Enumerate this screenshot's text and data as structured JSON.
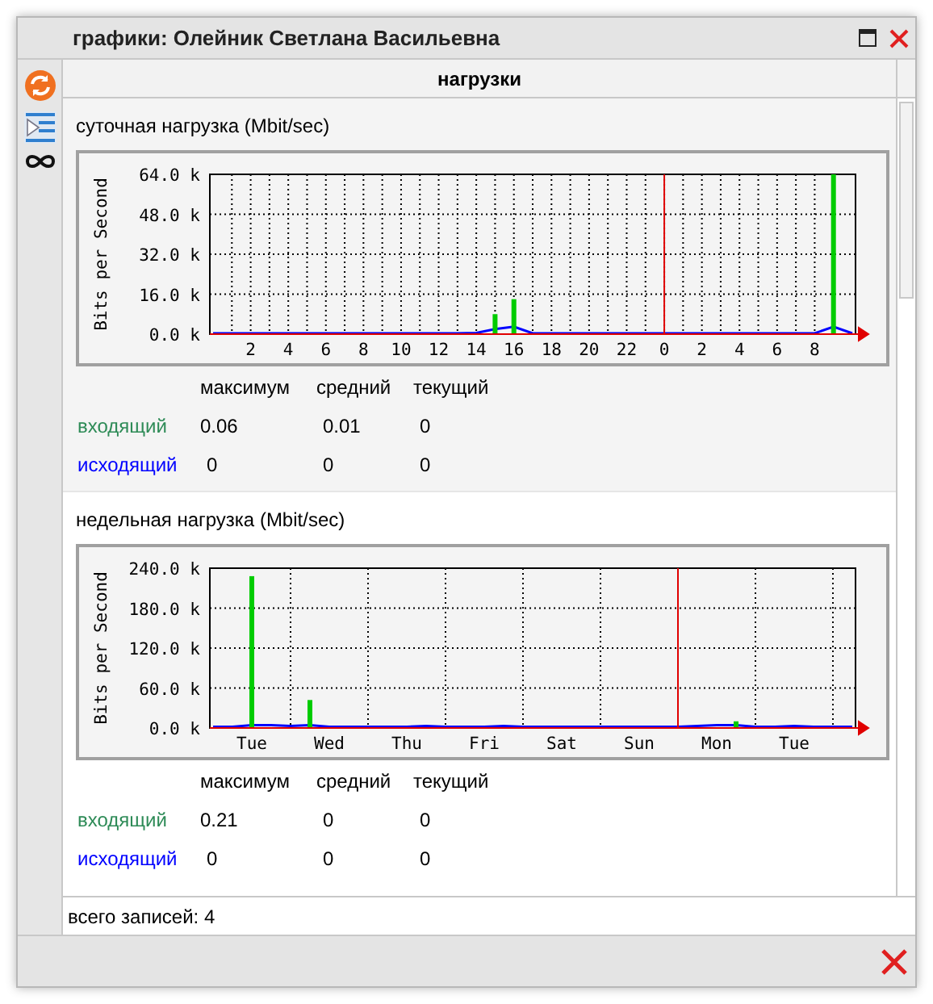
{
  "window": {
    "title": "графики: Олейник Светлана Васильевна"
  },
  "panel": {
    "title": "нагрузки"
  },
  "sections": [
    {
      "title": "суточная нагрузка (Mbit/sec)",
      "chart_data": {
        "type": "bar",
        "ylabel": "Bits per Second",
        "categories": [
          null,
          null,
          "2",
          null,
          "4",
          null,
          "6",
          null,
          "8",
          null,
          "10",
          null,
          "12",
          null,
          "14",
          null,
          "16",
          null,
          "18",
          null,
          "20",
          null,
          "22",
          null,
          "0",
          null,
          "2",
          null,
          "4",
          null,
          "6",
          null,
          "8",
          null,
          null
        ],
        "series": [
          {
            "name": "входящий",
            "color": "#00cc00",
            "values": [
              0,
              0,
              0,
              0,
              0,
              0,
              0,
              0,
              0,
              0,
              0,
              0,
              0,
              0,
              0,
              8,
              14,
              0,
              0,
              0,
              0,
              0,
              0,
              0,
              0,
              0,
              0,
              0,
              0,
              0,
              0,
              0,
              0,
              64,
              0
            ]
          },
          {
            "name": "исходящий",
            "color": "#0000ff",
            "type": "line",
            "values": [
              0.3,
              0.3,
              0.3,
              0.3,
              0.3,
              0.3,
              0.3,
              0.3,
              0.3,
              0.3,
              0.3,
              0.3,
              0.3,
              0.3,
              0.5,
              2,
              3,
              0.3,
              0.3,
              0.3,
              0.3,
              0.3,
              0.3,
              0.3,
              0.3,
              0.3,
              0.3,
              0.3,
              0.3,
              0.3,
              0.3,
              0.3,
              0.3,
              3,
              0.3
            ]
          }
        ],
        "ylim": [
          0,
          64
        ],
        "yticks": [
          {
            "value": 0,
            "label": "0.0 k"
          },
          {
            "value": 16,
            "label": "16.0 k"
          },
          {
            "value": 32,
            "label": "32.0 k"
          },
          {
            "value": 48,
            "label": "48.0 k"
          },
          {
            "value": 64,
            "label": "64.0 k"
          }
        ],
        "grid": true
      },
      "stats": {
        "columns": [
          "максимум",
          "средний",
          "текущий"
        ],
        "rows": [
          {
            "color": "#2e8b57",
            "values": [
              "0.06",
              "0.01",
              "0"
            ]
          },
          {
            "color": "#0000ff",
            "values": [
              "0",
              "0",
              "0"
            ]
          }
        ]
      }
    },
    {
      "title": "недельная нагрузка (Mbit/sec)",
      "chart_data": {
        "type": "bar",
        "ylabel": "Bits per Second",
        "categories": [
          null,
          null,
          "Tue",
          null,
          null,
          null,
          "Wed",
          null,
          null,
          null,
          "Thu",
          null,
          null,
          null,
          "Fri",
          null,
          null,
          null,
          "Sat",
          null,
          null,
          null,
          "Sun",
          null,
          null,
          null,
          "Mon",
          null,
          null,
          null,
          "Tue",
          null,
          null,
          null
        ],
        "series": [
          {
            "name": "входящий",
            "color": "#00cc00",
            "values": [
              0,
              0,
              228,
              0,
              0,
              42,
              0,
              0,
              0,
              0,
              0,
              0,
              0,
              0,
              0,
              0,
              0,
              0,
              0,
              0,
              0,
              0,
              0,
              0,
              0,
              0,
              0,
              10,
              0,
              0,
              0,
              0,
              0,
              0
            ]
          },
          {
            "name": "исходящий",
            "color": "#0000ff",
            "type": "line",
            "values": [
              2,
              2,
              4,
              4,
              3,
              4,
              2,
              2,
              2,
              2,
              2,
              3,
              2,
              2,
              2,
              3,
              2,
              2,
              2,
              2,
              2,
              2,
              2,
              2,
              2,
              3,
              4,
              4,
              2,
              2,
              3,
              2,
              2,
              2
            ]
          }
        ],
        "ylim": [
          0,
          240
        ],
        "yticks": [
          {
            "value": 0,
            "label": "0.0 k"
          },
          {
            "value": 60,
            "label": "60.0 k"
          },
          {
            "value": 120,
            "label": "120.0 k"
          },
          {
            "value": 180,
            "label": "180.0 k"
          },
          {
            "value": 240,
            "label": "240.0 k"
          }
        ],
        "grid": true
      },
      "stats": {
        "columns": [
          "максимум",
          "средний",
          "текущий"
        ],
        "rows": [
          {
            "color": "#2e8b57",
            "values": [
              "0.21",
              "0",
              "0"
            ]
          },
          {
            "color": "#0000ff",
            "values": [
              "0",
              "0",
              "0"
            ]
          }
        ]
      }
    }
  ],
  "status_bar": "всего записей: 4"
}
